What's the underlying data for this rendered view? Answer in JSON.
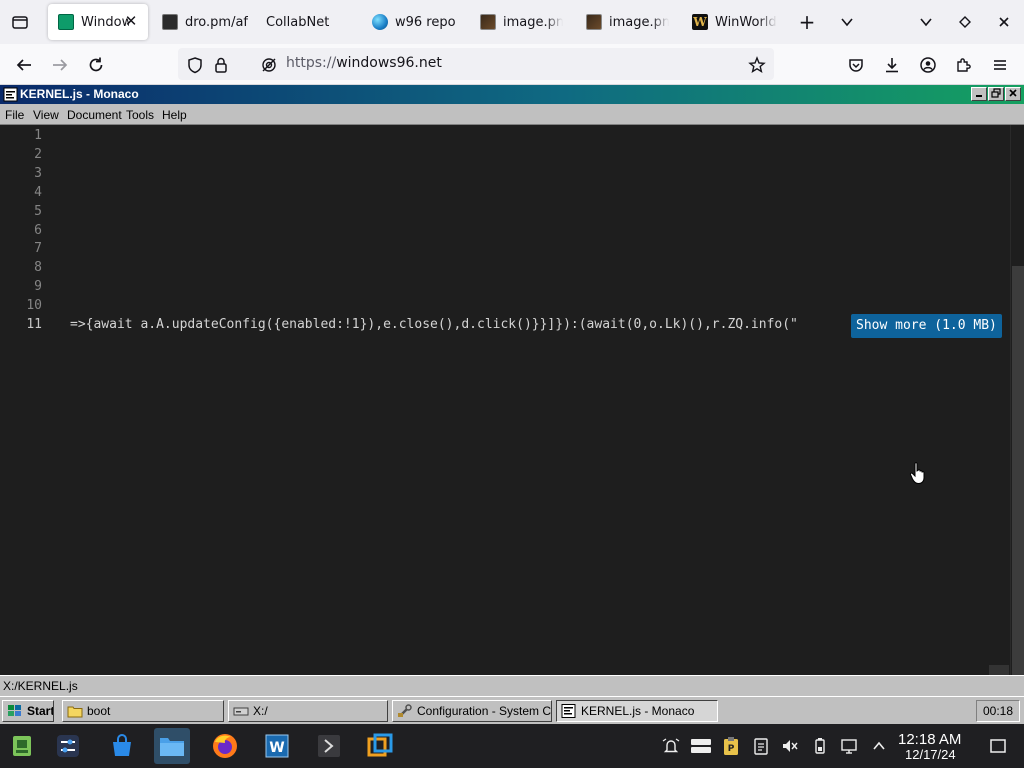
{
  "browser": {
    "tabs": [
      {
        "label": "Window",
        "active": true,
        "icon": "win96-icon"
      },
      {
        "label": "dro.pm/af",
        "icon": "dark-page-icon"
      },
      {
        "label": "CollabNet",
        "icon": "none"
      },
      {
        "label": "w96 repo",
        "icon": "globe-icon"
      },
      {
        "label": "image.pn",
        "icon": "image-icon"
      },
      {
        "label": "image.pn",
        "icon": "image-icon"
      },
      {
        "label": "WinWorld",
        "icon": "winworld-icon"
      }
    ],
    "close_glyph": "✕",
    "new_tab_glyph": "+",
    "url": {
      "scheme": "https://",
      "host": "windows96.net"
    }
  },
  "window": {
    "title": "KERNEL.js - Monaco",
    "menu": [
      "File",
      "View",
      "Document",
      "Tools",
      "Help"
    ]
  },
  "editor": {
    "line_numbers": [
      "1",
      "2",
      "3",
      "4",
      "5",
      "6",
      "7",
      "8",
      "9",
      "10",
      "11"
    ],
    "line11": "=>{await a.A.updateConfig({enabled:!1}),e.close(),d.click()}}]}):(await(0,o.Lk)(),r.ZQ.info(\"",
    "show_more": "Show more (1.0 MB)"
  },
  "statusbar": {
    "path": "X:/KERNEL.js"
  },
  "w96_taskbar": {
    "start": "Start",
    "buttons": [
      {
        "label": "boot"
      },
      {
        "label": "X:/"
      },
      {
        "label": "Configuration - System Con..."
      },
      {
        "label": "KERNEL.js - Monaco",
        "active": true
      }
    ],
    "clock": "00:18"
  },
  "host": {
    "time": "12:18 AM",
    "date": "12/17/24"
  },
  "colors": {
    "editor_bg": "#1e1e1e",
    "show_more_bg": "#0e639c",
    "titlebar_start": "#0a2a6a",
    "titlebar_end": "#15a060",
    "w96_face": "#c0c0c0"
  }
}
